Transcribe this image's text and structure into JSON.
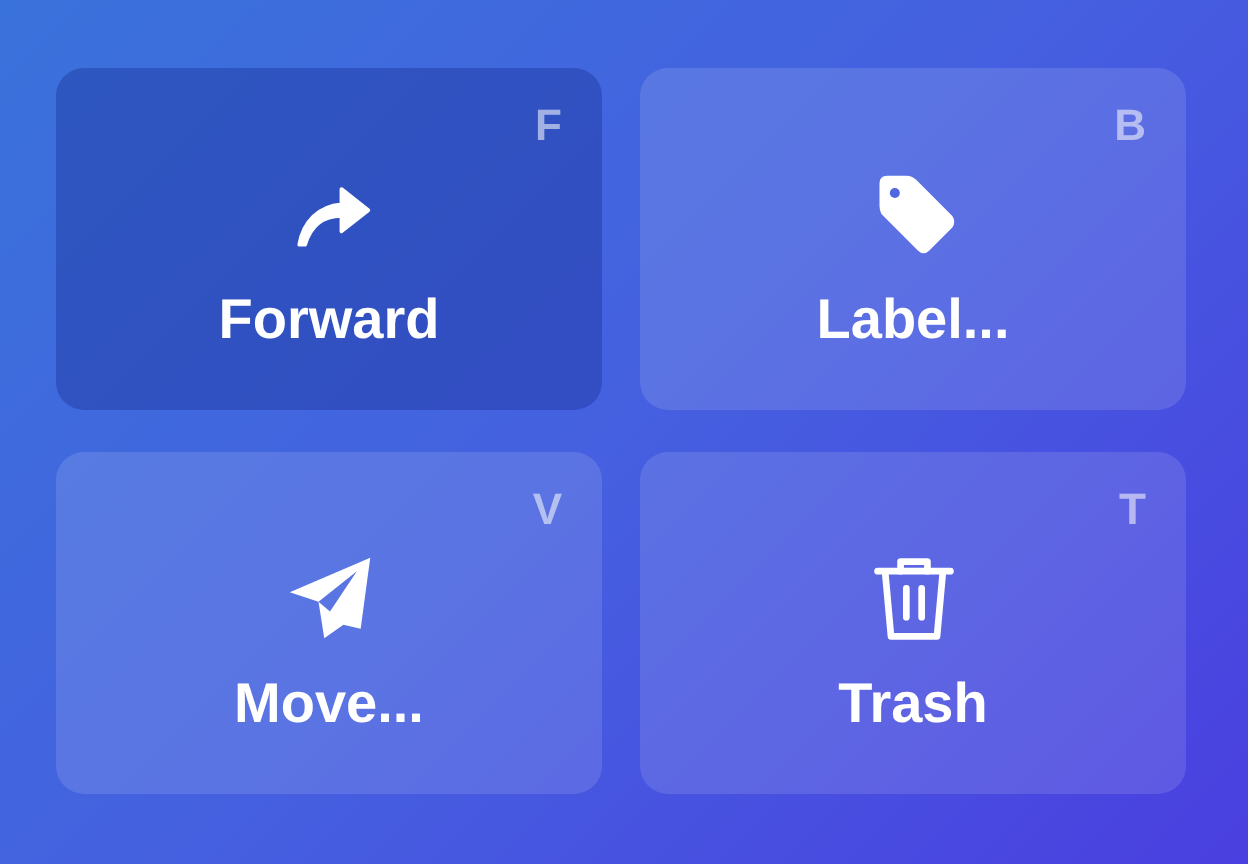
{
  "actions": [
    {
      "kind": "forward",
      "label": "Forward",
      "shortcut": "F",
      "selected": true
    },
    {
      "kind": "label",
      "label": "Label...",
      "shortcut": "B",
      "selected": false
    },
    {
      "kind": "move",
      "label": "Move...",
      "shortcut": "V",
      "selected": false
    },
    {
      "kind": "trash",
      "label": "Trash",
      "shortcut": "T",
      "selected": false
    }
  ]
}
